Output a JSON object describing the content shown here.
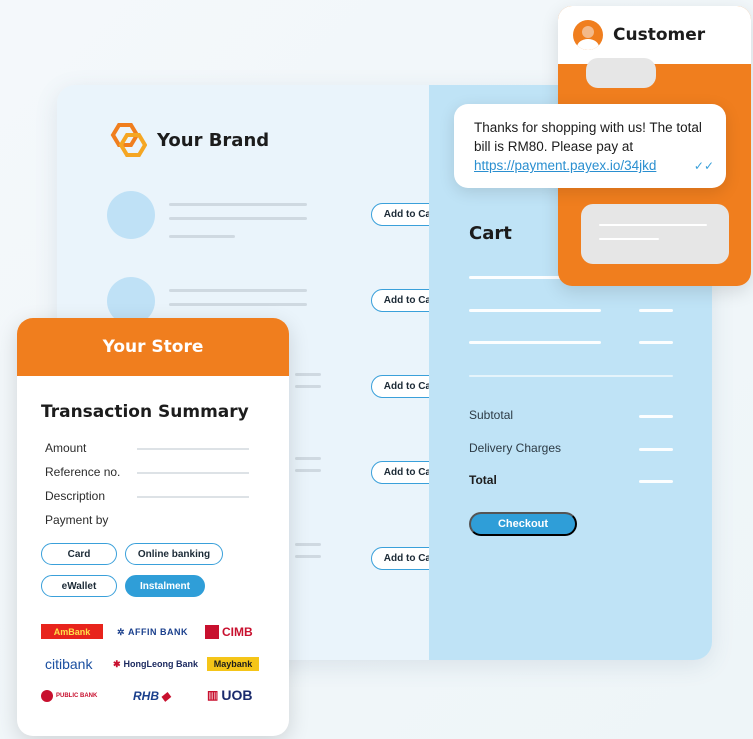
{
  "brand": {
    "name": "Your Brand"
  },
  "products": [
    {
      "add_label": "Add to Cart"
    },
    {
      "add_label": "Add to Cart"
    },
    {
      "add_label": "Add to Cart"
    },
    {
      "add_label": "Add to Cart"
    },
    {
      "add_label": "Add to Cart"
    }
  ],
  "cart": {
    "title": "Cart",
    "subtotal_label": "Subtotal",
    "delivery_label": "Delivery Charges",
    "total_label": "Total",
    "checkout_label": "Checkout"
  },
  "chat": {
    "customer_name": "Customer",
    "message_text": "Thanks for shopping with us! The total bill is RM80. Please pay at ",
    "message_link": "https://payment.payex.io/34jkd",
    "read_icon": "double-check-icon"
  },
  "store": {
    "title": "Your Store",
    "summary_title": "Transaction Summary",
    "fields": [
      "Amount",
      "Reference no.",
      "Description",
      "Payment by"
    ],
    "payment_methods": [
      "Card",
      "Online banking",
      "eWallet",
      "Instalment"
    ],
    "selected_method": "Instalment"
  },
  "banks": {
    "ambank": "AmBank",
    "affin": "AFFIN BANK",
    "cimb": "CIMB",
    "citi": "citibank",
    "hongleong": "HongLeong Bank",
    "maybank": "Maybank",
    "public": "PUBLIC BANK",
    "rhb": "RHB",
    "uob": "UOB"
  },
  "colors": {
    "accent_orange": "#f07e1e",
    "accent_blue": "#2f9ed8",
    "store_bg": "#eaf4fb",
    "cart_bg": "#bfe3f6"
  }
}
